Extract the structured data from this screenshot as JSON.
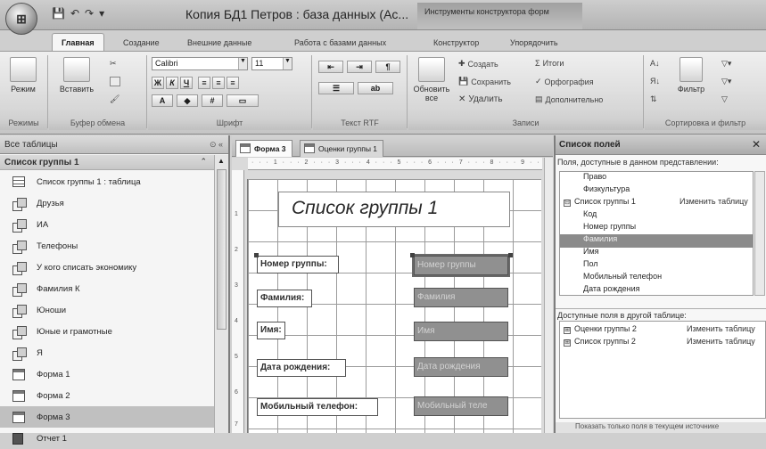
{
  "app": {
    "title": "Копия БД1 Петров : база данных (Ac...",
    "context_tools": "Инструменты конструктора форм",
    "office_button": "⊞",
    "qat": [
      "💾",
      "↶",
      "↷",
      "▾"
    ]
  },
  "tabs": [
    {
      "label": "Главная",
      "active": true
    },
    {
      "label": "Создание"
    },
    {
      "label": "Внешние данные"
    },
    {
      "label": "Работа с базами данных"
    },
    {
      "label": "Конструктор"
    },
    {
      "label": "Упорядочить"
    }
  ],
  "ribbon": {
    "views": {
      "button": "Режим",
      "group": "Режимы"
    },
    "clipboard": {
      "paste": "Вставить",
      "group": "Буфер обмена"
    },
    "font": {
      "font_name": "Calibri",
      "font_size": "11",
      "group": "Шрифт"
    },
    "richtext": {
      "group": "Текст RTF"
    },
    "records": {
      "refresh": "Обновить все",
      "create": "Создать",
      "save": "Сохранить",
      "delete": "Удалить",
      "totals": "Итоги",
      "spelling": "Орфография",
      "more": "Дополнительно",
      "group": "Записи"
    },
    "sort": {
      "filter": "Фильтр",
      "group": "Сортировка и фильтр"
    }
  },
  "nav": {
    "header": "Все таблицы",
    "group": "Список группы 1",
    "items": [
      {
        "label": "Список группы 1 : таблица",
        "type": "table"
      },
      {
        "label": "Друзья",
        "type": "query"
      },
      {
        "label": "ИА",
        "type": "query"
      },
      {
        "label": "Телефоны",
        "type": "query"
      },
      {
        "label": "У кого списать экономику",
        "type": "query"
      },
      {
        "label": "Фамилия К",
        "type": "query"
      },
      {
        "label": "Юноши",
        "type": "query"
      },
      {
        "label": "Юные и грамотные",
        "type": "query"
      },
      {
        "label": "Я",
        "type": "query"
      },
      {
        "label": "Форма 1",
        "type": "form"
      },
      {
        "label": "Форма 2",
        "type": "form"
      },
      {
        "label": "Форма 3",
        "type": "form",
        "selected": true
      },
      {
        "label": "Отчет 1",
        "type": "report"
      }
    ]
  },
  "doc_tabs": [
    "Форма 3",
    "Оценки группы 1"
  ],
  "form": {
    "ruler": "· · · 1 · · · 2 · · · 3 · · · 4 · · · 5 · · · 6 · · · 7 · · · 8 · · · 9 · ·",
    "ruler_left": [
      "1",
      "2",
      "3",
      "4",
      "5",
      "6",
      "7"
    ],
    "caption": "Список группы 1",
    "labels": [
      "Номер группы:",
      "Фамилия:",
      "Имя:",
      "Дата рождения:",
      "Мобильный телефон:"
    ],
    "fields": [
      "Номер группы",
      "Фамилия",
      "Имя",
      "Дата рождения",
      "Мобильный теле"
    ]
  },
  "field_list": {
    "title": "Список полей",
    "available_header": "Поля, доступные в данном представлении:",
    "items": [
      {
        "label": "Право",
        "indent": 2
      },
      {
        "label": "Физкультура",
        "indent": 2
      },
      {
        "label": "Список группы 1",
        "indent": 1,
        "expand": "⊟",
        "link": "Изменить таблицу"
      },
      {
        "label": "Код",
        "indent": 2
      },
      {
        "label": "Номер группы",
        "indent": 2
      },
      {
        "label": "Фамилия",
        "indent": 2,
        "selected": true
      },
      {
        "label": "Имя",
        "indent": 2
      },
      {
        "label": "Пол",
        "indent": 2
      },
      {
        "label": "Мобильный телефон",
        "indent": 2
      },
      {
        "label": "Дата рождения",
        "indent": 2
      }
    ],
    "other_header": "Доступные поля в другой таблице:",
    "other_items": [
      {
        "label": "Оценки группы 2",
        "expand": "⊞",
        "link": "Изменить таблицу"
      },
      {
        "label": "Список группы 2",
        "expand": "⊞",
        "link": "Изменить таблицу"
      }
    ],
    "footer": "Показать только поля в текущем источнике"
  }
}
